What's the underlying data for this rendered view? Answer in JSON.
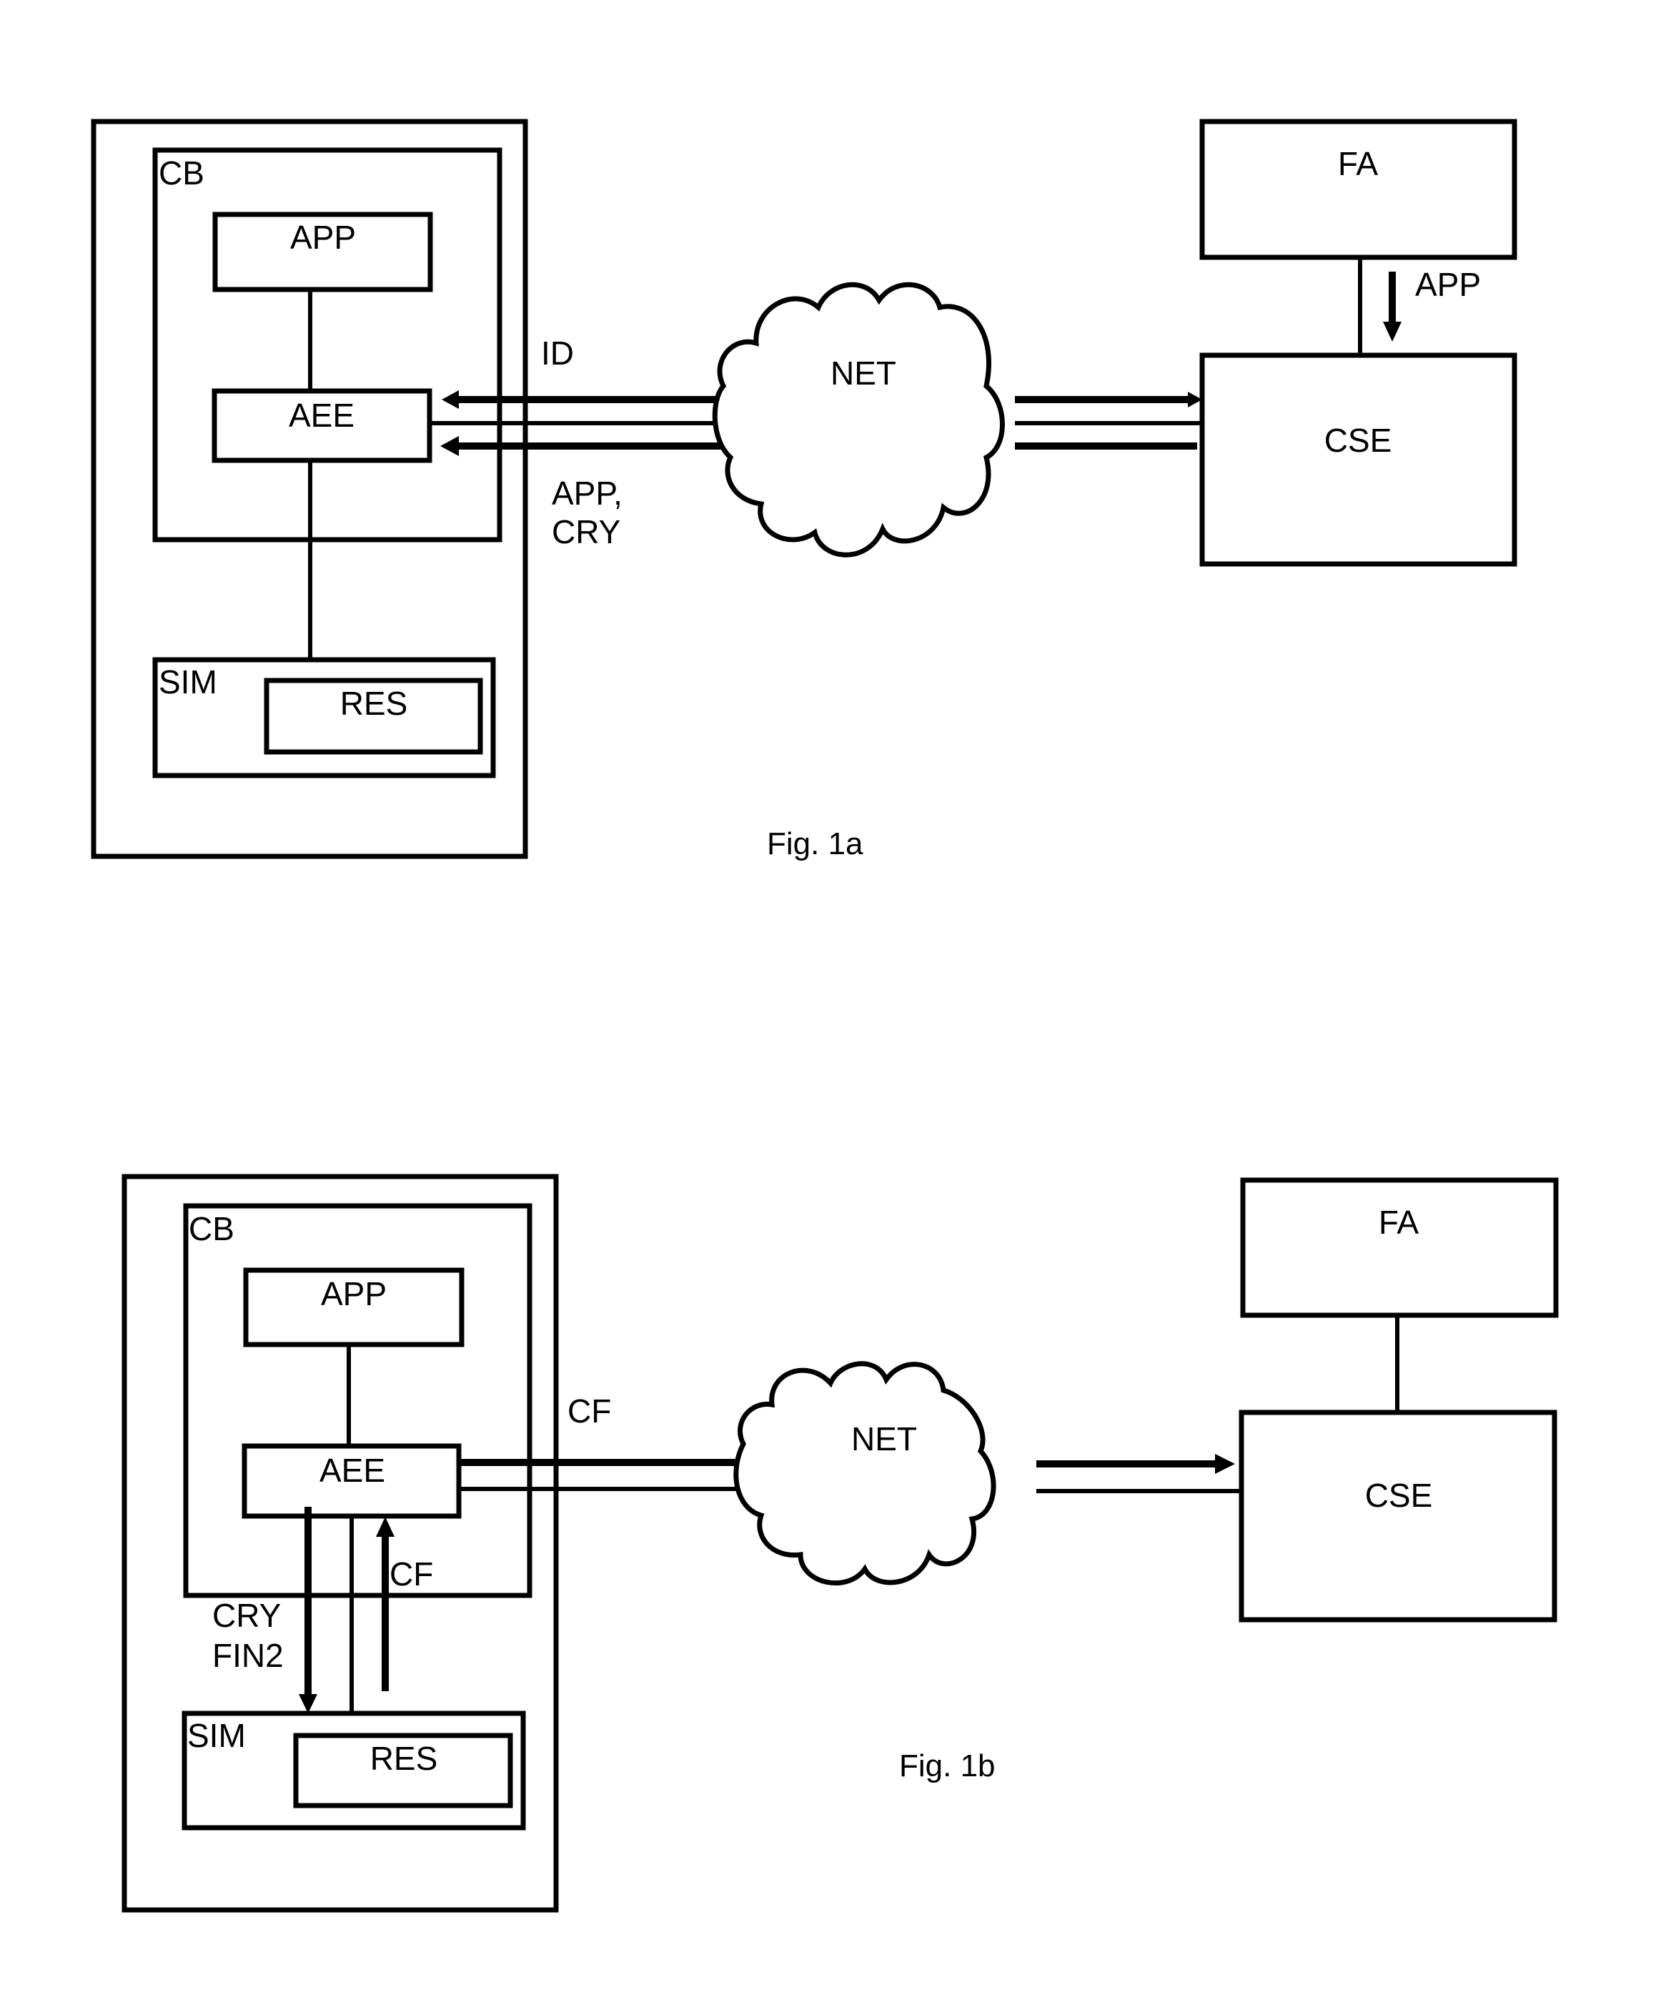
{
  "figures": [
    {
      "caption": "Fig. 1a",
      "nodes": {
        "device": "",
        "cb": "CB",
        "app": "APP",
        "aee": "AEE",
        "sim": "SIM",
        "res": "RES",
        "net": "NET",
        "fa": "FA",
        "cse": "CSE"
      },
      "edge_labels": {
        "id": "ID",
        "app_cry_line1": "APP,",
        "app_cry_line2": "CRY",
        "fa_to_cse": "APP"
      }
    },
    {
      "caption": "Fig. 1b",
      "nodes": {
        "device": "",
        "cb": "CB",
        "app": "APP",
        "aee": "AEE",
        "sim": "SIM",
        "res": "RES",
        "net": "NET",
        "fa": "FA",
        "cse": "CSE"
      },
      "edge_labels": {
        "cf_net": "CF",
        "cf_sim": "CF",
        "cry_line1": "CRY",
        "cry_line2": "FIN2"
      }
    }
  ]
}
